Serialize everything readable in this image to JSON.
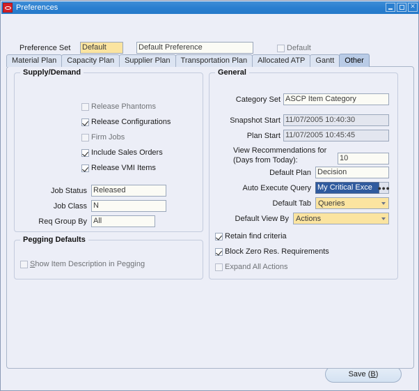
{
  "window": {
    "title": "Preferences",
    "logo_icon": "oracle-logo-icon",
    "controls": {
      "minimize": "minimize-icon",
      "maximize": "maximize-icon",
      "close": "✕"
    }
  },
  "header": {
    "preference_set_label": "Preference Set",
    "preference_set_value": "Default",
    "preference_description_value": "Default Preference",
    "default_checkbox_label": "Default",
    "default_checkbox_checked": false
  },
  "tabs": [
    {
      "label": "Material Plan",
      "active": false
    },
    {
      "label": "Capacity Plan",
      "active": false
    },
    {
      "label": "Supplier Plan",
      "active": false
    },
    {
      "label": "Transportation Plan",
      "active": false
    },
    {
      "label": "Allocated ATP",
      "active": false
    },
    {
      "label": "Gantt",
      "active": false
    },
    {
      "label": "Other",
      "active": true
    }
  ],
  "supply_demand": {
    "title": "Supply/Demand",
    "checkboxes": [
      {
        "label": "Release Phantoms",
        "checked": false,
        "disabled": true
      },
      {
        "label": "Release Configurations",
        "checked": true,
        "disabled": false
      },
      {
        "label": "Firm Jobs",
        "checked": false,
        "disabled": true
      },
      {
        "label": "Include Sales Orders",
        "checked": true,
        "disabled": false
      },
      {
        "label": "Release VMI Items",
        "checked": true,
        "disabled": false
      }
    ],
    "fields": [
      {
        "label": "Job Status",
        "value": "Released"
      },
      {
        "label": "Job Class",
        "value": "N"
      },
      {
        "label": "Req Group By",
        "value": "All"
      }
    ]
  },
  "pegging": {
    "title": "Pegging Defaults",
    "checkbox": {
      "label_mnemonic": "S",
      "label_rest": "how Item Description in Pegging",
      "checked": false,
      "disabled": true
    }
  },
  "general": {
    "title": "General",
    "category_set_label": "Category Set",
    "category_set_value": "ASCP Item Category",
    "snapshot_start_label": "Snapshot Start",
    "snapshot_start_value": "11/07/2005 10:40:30",
    "plan_start_label": "Plan Start",
    "plan_start_value": "11/07/2005 10:45:45",
    "view_recommendations_label_line1": "View Recommendations for",
    "view_recommendations_label_line2": "(Days from Today):",
    "view_recommendations_value": "10",
    "default_plan_label": "Default Plan",
    "default_plan_value": "Decision",
    "auto_execute_query_label": "Auto Execute Query",
    "auto_execute_query_value": "My Critical Exce",
    "auto_execute_query_lov_icon": "list-of-values-icon",
    "default_tab_label": "Default Tab",
    "default_tab_value": "Queries",
    "default_view_by_label": "Default View By",
    "default_view_by_value": "Actions",
    "checkboxes": [
      {
        "label": "Retain find criteria",
        "checked": true
      },
      {
        "label": "Block Zero Res. Requirements",
        "checked": true
      },
      {
        "label": "Expand All Actions",
        "checked": false
      }
    ]
  },
  "footer": {
    "save_label_pre": "Save (",
    "save_mnemonic": "B",
    "save_label_post": ")"
  }
}
